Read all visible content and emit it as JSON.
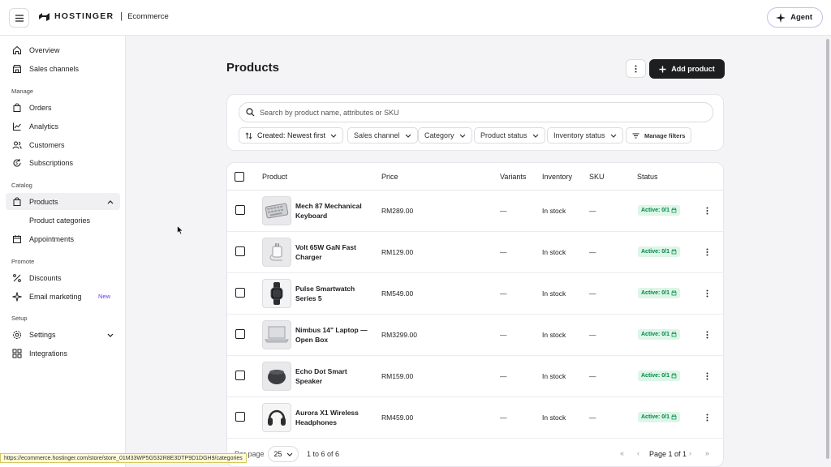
{
  "header": {
    "brand": "HOSTINGER",
    "separator": "|",
    "app": "Ecommerce",
    "agent_label": "Agent"
  },
  "sidebar": {
    "items_top": [
      {
        "label": "Overview",
        "icon": "home-icon"
      },
      {
        "label": "Sales channels",
        "icon": "store-icon"
      }
    ],
    "manage_label": "Manage",
    "manage": [
      {
        "label": "Orders",
        "icon": "bag-icon"
      },
      {
        "label": "Analytics",
        "icon": "chart-icon"
      },
      {
        "label": "Customers",
        "icon": "users-icon"
      },
      {
        "label": "Subscriptions",
        "icon": "refresh-icon"
      }
    ],
    "catalog_label": "Catalog",
    "catalog": [
      {
        "label": "Products",
        "icon": "bag-icon"
      },
      {
        "label": "Product categories",
        "icon": ""
      },
      {
        "label": "Appointments",
        "icon": "calendar-icon"
      }
    ],
    "promote_label": "Promote",
    "promote": [
      {
        "label": "Discounts",
        "icon": "percent-icon"
      },
      {
        "label": "Email marketing",
        "icon": "sparkle-icon",
        "badge": "New"
      }
    ],
    "setup_label": "Setup",
    "setup": [
      {
        "label": "Settings",
        "icon": "gear-icon"
      },
      {
        "label": "Integrations",
        "icon": "grid-icon"
      }
    ]
  },
  "main": {
    "title": "Products",
    "add_button": "Add product",
    "search_placeholder": "Search by product name, attributes or SKU",
    "filters": {
      "sort": "Created: Newest first",
      "sales_channel": "Sales channel",
      "category": "Category",
      "product_status": "Product status",
      "inventory_status": "Inventory status",
      "manage_filters": "Manage filters"
    },
    "columns": {
      "product": "Product",
      "price": "Price",
      "variants": "Variants",
      "inventory": "Inventory",
      "sku": "SKU",
      "status": "Status"
    },
    "rows": [
      {
        "name": "Mech 87 Mechanical Keyboard",
        "price": "RM289.00",
        "variants": "—",
        "inventory": "In stock",
        "sku": "—",
        "status": "Active: 0/1"
      },
      {
        "name": "Volt 65W GaN Fast Charger",
        "price": "RM129.00",
        "variants": "—",
        "inventory": "In stock",
        "sku": "—",
        "status": "Active: 0/1"
      },
      {
        "name": "Pulse Smartwatch Series 5",
        "price": "RM549.00",
        "variants": "—",
        "inventory": "In stock",
        "sku": "—",
        "status": "Active: 0/1"
      },
      {
        "name": "Nimbus 14\" Laptop — Open Box",
        "price": "RM3299.00",
        "variants": "—",
        "inventory": "In stock",
        "sku": "—",
        "status": "Active: 0/1"
      },
      {
        "name": "Echo Dot Smart Speaker",
        "price": "RM159.00",
        "variants": "—",
        "inventory": "In stock",
        "sku": "—",
        "status": "Active: 0/1"
      },
      {
        "name": "Aurora X1 Wireless Headphones",
        "price": "RM459.00",
        "variants": "—",
        "inventory": "In stock",
        "sku": "—",
        "status": "Active: 0/1"
      }
    ],
    "pager": {
      "per_page_label": "Per page",
      "per_page": "25",
      "range": "1 to 6 of 6",
      "page_text": "Page 1 of 1"
    }
  },
  "statusbar_url": "https://ecommerce.hostinger.com/store/store_01M33WP5G532R8E3DTP9D1DGH9/categories",
  "colors": {
    "accent": "#673de6",
    "active_bg": "#ddf6e6",
    "active_text": "#00864a",
    "primary_button": "#1d1e20"
  }
}
